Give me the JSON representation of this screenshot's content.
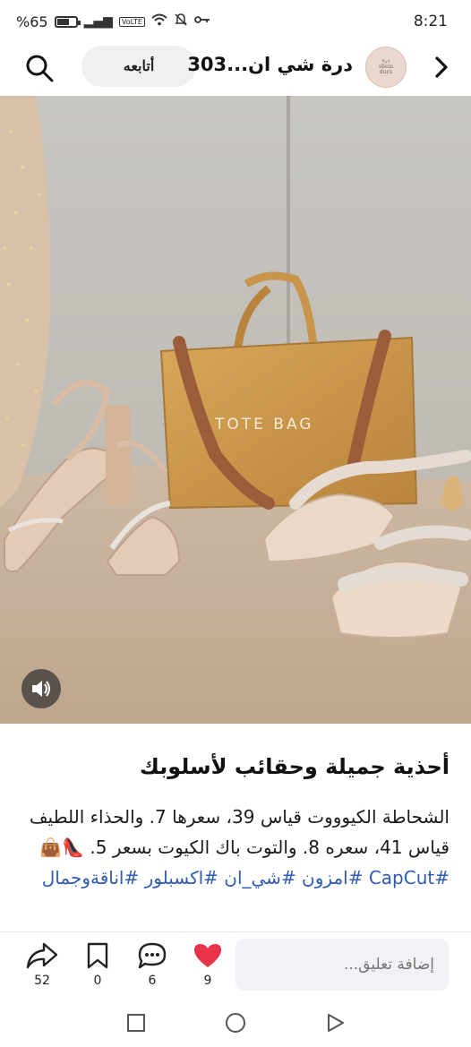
{
  "status_bar": {
    "time": "8:21",
    "battery_text": "%65",
    "battery_level": 0.65,
    "network_badge": "VoLTE",
    "icons": [
      "battery-icon",
      "signal-icon",
      "wifi-icon",
      "mute-icon",
      "key-icon"
    ]
  },
  "header": {
    "page_name": "درة شي ان...303",
    "avatar_text": [
      "درة",
      "shein",
      "dura"
    ],
    "follow_label": "أتابعه",
    "icons": [
      "back-arrow-icon",
      "search-icon"
    ]
  },
  "post": {
    "image_text": "TOTE BAG",
    "title": "أحذية جميلة وحقائب لأسلوبك",
    "body": "الشحاطة الكيوووت قياس 39، سعرها 7. والحذاء اللطيف قياس 41، سعره 8. والتوت باك الكيوت بسعر 5.",
    "emojis": "👠👜",
    "hashtags": "#CapCut #امزون #شي_ان #اكسبلور #اناقةوجمال"
  },
  "actions": {
    "shares": "52",
    "saves": "0",
    "comments": "6",
    "likes": "9",
    "comment_placeholder": "إضافة تعليق...",
    "like_color": "#e8334a"
  },
  "navbar": {
    "icons": [
      "recent-apps-icon",
      "home-icon",
      "back-icon"
    ]
  }
}
